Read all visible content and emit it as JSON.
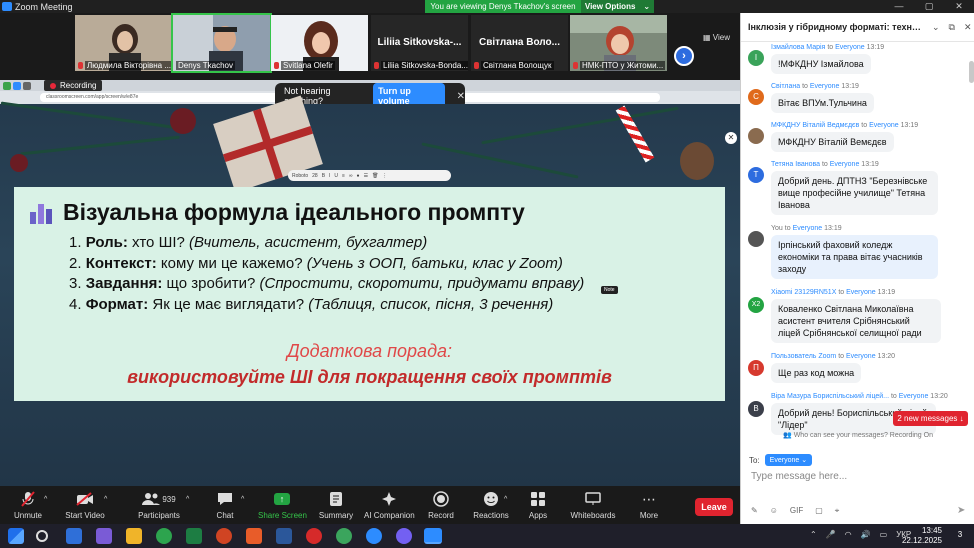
{
  "window": {
    "title": "Zoom Meeting",
    "viewing_banner": "You are viewing Denys Tkachov's screen",
    "view_options": "View Options",
    "view_label": "View"
  },
  "gallery": [
    {
      "name": "Людмила Вікторівна ...",
      "kind": "photo",
      "mic_muted": true
    },
    {
      "name": "Denys Tkachov",
      "kind": "photo",
      "active": true
    },
    {
      "name": "Svitlana Olefir",
      "kind": "photo",
      "mic_muted": true
    },
    {
      "name": "Liliia Sitkovska-Bonda...",
      "display": "Liliia Sitkovska-...",
      "kind": "text",
      "mic_muted": true
    },
    {
      "name": "Світлана Волощук",
      "display": "Світлана Воло...",
      "kind": "text",
      "mic_muted": true
    },
    {
      "name": "НМК-ПТО у Житоми...",
      "kind": "photo",
      "mic_muted": true
    }
  ],
  "share": {
    "recording_label": "Recording",
    "audio_hint": "Not hearing anything?",
    "turn_up_label": "Turn up volume",
    "url": "classroomscreen.com/app/screen/w/e87e",
    "mini_toolbar_font": "Roboto",
    "mini_toolbar_size": "28",
    "note_label": "Note"
  },
  "slide": {
    "title": "Візуальна формула ідеального промпту",
    "items": [
      {
        "num": "1.",
        "key": "Роль:",
        "text": " хто ШІ? ",
        "example": "(Вчитель, асистент, бухгалтер)"
      },
      {
        "num": "2.",
        "key": "Контекст:",
        "text": " кому ми це кажемо? ",
        "example": "(Учень з ООП, батьки, клас у Zoom)"
      },
      {
        "num": "3.",
        "key": "Завдання:",
        "text": " що зробити? ",
        "example": "(Спростити, скоротити, придумати вправу)"
      },
      {
        "num": "4.",
        "key": "Формат:",
        "text": " Як це має виглядати? ",
        "example": "(Таблиця, список, пісня, 3 речення)"
      }
    ],
    "tip_heading": "Додаткова порада:",
    "tip_text": "використовуйте ШІ для покращення своїх промптів"
  },
  "controls": [
    {
      "label": "Unmute",
      "icon": "mic-muted-icon"
    },
    {
      "label": "Start Video",
      "icon": "video-off-icon"
    },
    {
      "label": "Participants",
      "icon": "participants-icon",
      "count": "939"
    },
    {
      "label": "Chat",
      "icon": "chat-icon"
    },
    {
      "label": "Share Screen",
      "icon": "share-screen-icon"
    },
    {
      "label": "Summary",
      "icon": "summary-icon"
    },
    {
      "label": "AI Companion",
      "icon": "ai-companion-icon"
    },
    {
      "label": "Record",
      "icon": "record-icon"
    },
    {
      "label": "Reactions",
      "icon": "reactions-icon"
    },
    {
      "label": "Apps",
      "icon": "apps-icon"
    },
    {
      "label": "Whiteboards",
      "icon": "whiteboard-icon"
    },
    {
      "label": "More",
      "icon": "more-icon"
    }
  ],
  "leave_label": "Leave",
  "chat": {
    "title": "Інклюзія у гібридному форматі: технологі...",
    "messages": [
      {
        "from": "Ізмайлова Марія",
        "to": "Everyone",
        "time": "13:19",
        "initial": "I",
        "color": "#3aa35a",
        "text": "!МФКДНУ Ізмайлова"
      },
      {
        "from": "Світлана",
        "to": "Everyone",
        "time": "13:19",
        "initial": "C",
        "color": "#e06a1b",
        "text": "Вітає ВПУм.Тульчина"
      },
      {
        "from": "МФКДНУ Віталій Ведмєдєв",
        "to": "Everyone",
        "time": "13:19",
        "initial": "",
        "color": "#8a6b4f",
        "text": "МФКДНУ Віталій Вемєдєв"
      },
      {
        "from": "Тетяна Іванова",
        "to": "Everyone",
        "time": "13:19",
        "initial": "T",
        "color": "#2d6cdf",
        "text": "Добрий день. ДПТНЗ \"Березнівське вище професійне училище\" Тетяна Іванова"
      },
      {
        "from": "You",
        "to": "Everyone",
        "time": "13:19",
        "initial": "",
        "color": "#555",
        "text": "Ірпінський фаховий коледж економіки та права вітає учасників заходу",
        "self": true
      },
      {
        "from": "Xiaomi 23129RN51X",
        "to": "Everyone",
        "time": "13:19",
        "initial": "X2",
        "color": "#23a442",
        "text": "Коваленко Світлана Миколаївна асистент вчителя Срібнянський ліцей Срібнянської селищної ради"
      },
      {
        "from": "Пользователь Zoom",
        "to": "Everyone",
        "time": "13:20",
        "initial": "П",
        "color": "#d6392e",
        "text": "Ще раз код можна"
      },
      {
        "from": "Віра Мазура Бориспільський ліцей...",
        "to": "Everyone",
        "time": "13:20",
        "initial": "B",
        "color": "#3b3f4a",
        "text": "Добрий день! Бориспільський ліцей \"Лідер\""
      }
    ],
    "new_messages": "2 new messages",
    "who_can_see": "Who can see your messages? Recording On",
    "to_label": "To:",
    "to_value": "Everyone",
    "input_placeholder": "Type message here...",
    "to_word": "to"
  },
  "taskbar": {
    "time": "13:45",
    "date": "22.12.2025",
    "lang": "УКР",
    "notif_count": "3"
  }
}
